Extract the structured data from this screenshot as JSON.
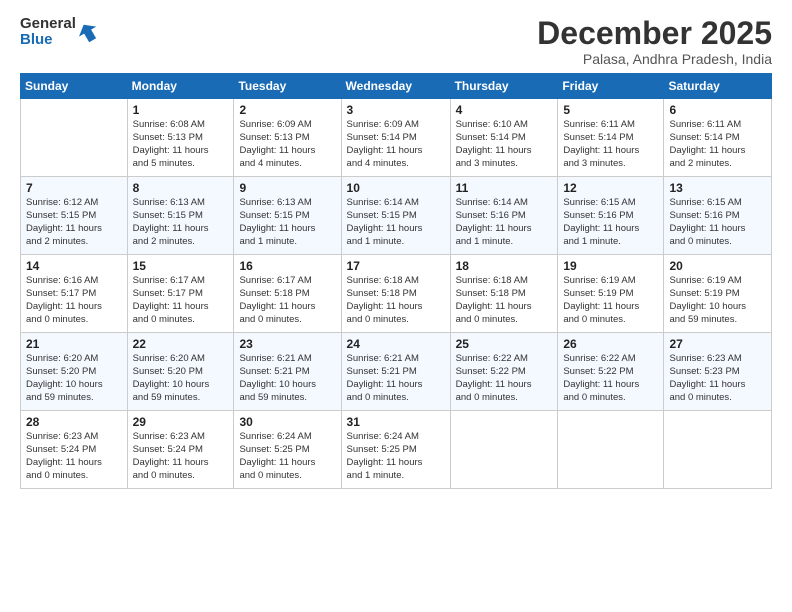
{
  "logo": {
    "line1": "General",
    "line2": "Blue"
  },
  "title": "December 2025",
  "location": "Palasa, Andhra Pradesh, India",
  "days_of_week": [
    "Sunday",
    "Monday",
    "Tuesday",
    "Wednesday",
    "Thursday",
    "Friday",
    "Saturday"
  ],
  "rows": [
    [
      {
        "day": "",
        "info": ""
      },
      {
        "day": "1",
        "info": "Sunrise: 6:08 AM\nSunset: 5:13 PM\nDaylight: 11 hours\nand 5 minutes."
      },
      {
        "day": "2",
        "info": "Sunrise: 6:09 AM\nSunset: 5:13 PM\nDaylight: 11 hours\nand 4 minutes."
      },
      {
        "day": "3",
        "info": "Sunrise: 6:09 AM\nSunset: 5:14 PM\nDaylight: 11 hours\nand 4 minutes."
      },
      {
        "day": "4",
        "info": "Sunrise: 6:10 AM\nSunset: 5:14 PM\nDaylight: 11 hours\nand 3 minutes."
      },
      {
        "day": "5",
        "info": "Sunrise: 6:11 AM\nSunset: 5:14 PM\nDaylight: 11 hours\nand 3 minutes."
      },
      {
        "day": "6",
        "info": "Sunrise: 6:11 AM\nSunset: 5:14 PM\nDaylight: 11 hours\nand 2 minutes."
      }
    ],
    [
      {
        "day": "7",
        "info": "Sunrise: 6:12 AM\nSunset: 5:15 PM\nDaylight: 11 hours\nand 2 minutes."
      },
      {
        "day": "8",
        "info": "Sunrise: 6:13 AM\nSunset: 5:15 PM\nDaylight: 11 hours\nand 2 minutes."
      },
      {
        "day": "9",
        "info": "Sunrise: 6:13 AM\nSunset: 5:15 PM\nDaylight: 11 hours\nand 1 minute."
      },
      {
        "day": "10",
        "info": "Sunrise: 6:14 AM\nSunset: 5:15 PM\nDaylight: 11 hours\nand 1 minute."
      },
      {
        "day": "11",
        "info": "Sunrise: 6:14 AM\nSunset: 5:16 PM\nDaylight: 11 hours\nand 1 minute."
      },
      {
        "day": "12",
        "info": "Sunrise: 6:15 AM\nSunset: 5:16 PM\nDaylight: 11 hours\nand 1 minute."
      },
      {
        "day": "13",
        "info": "Sunrise: 6:15 AM\nSunset: 5:16 PM\nDaylight: 11 hours\nand 0 minutes."
      }
    ],
    [
      {
        "day": "14",
        "info": "Sunrise: 6:16 AM\nSunset: 5:17 PM\nDaylight: 11 hours\nand 0 minutes."
      },
      {
        "day": "15",
        "info": "Sunrise: 6:17 AM\nSunset: 5:17 PM\nDaylight: 11 hours\nand 0 minutes."
      },
      {
        "day": "16",
        "info": "Sunrise: 6:17 AM\nSunset: 5:18 PM\nDaylight: 11 hours\nand 0 minutes."
      },
      {
        "day": "17",
        "info": "Sunrise: 6:18 AM\nSunset: 5:18 PM\nDaylight: 11 hours\nand 0 minutes."
      },
      {
        "day": "18",
        "info": "Sunrise: 6:18 AM\nSunset: 5:18 PM\nDaylight: 11 hours\nand 0 minutes."
      },
      {
        "day": "19",
        "info": "Sunrise: 6:19 AM\nSunset: 5:19 PM\nDaylight: 11 hours\nand 0 minutes."
      },
      {
        "day": "20",
        "info": "Sunrise: 6:19 AM\nSunset: 5:19 PM\nDaylight: 10 hours\nand 59 minutes."
      }
    ],
    [
      {
        "day": "21",
        "info": "Sunrise: 6:20 AM\nSunset: 5:20 PM\nDaylight: 10 hours\nand 59 minutes."
      },
      {
        "day": "22",
        "info": "Sunrise: 6:20 AM\nSunset: 5:20 PM\nDaylight: 10 hours\nand 59 minutes."
      },
      {
        "day": "23",
        "info": "Sunrise: 6:21 AM\nSunset: 5:21 PM\nDaylight: 10 hours\nand 59 minutes."
      },
      {
        "day": "24",
        "info": "Sunrise: 6:21 AM\nSunset: 5:21 PM\nDaylight: 11 hours\nand 0 minutes."
      },
      {
        "day": "25",
        "info": "Sunrise: 6:22 AM\nSunset: 5:22 PM\nDaylight: 11 hours\nand 0 minutes."
      },
      {
        "day": "26",
        "info": "Sunrise: 6:22 AM\nSunset: 5:22 PM\nDaylight: 11 hours\nand 0 minutes."
      },
      {
        "day": "27",
        "info": "Sunrise: 6:23 AM\nSunset: 5:23 PM\nDaylight: 11 hours\nand 0 minutes."
      }
    ],
    [
      {
        "day": "28",
        "info": "Sunrise: 6:23 AM\nSunset: 5:24 PM\nDaylight: 11 hours\nand 0 minutes."
      },
      {
        "day": "29",
        "info": "Sunrise: 6:23 AM\nSunset: 5:24 PM\nDaylight: 11 hours\nand 0 minutes."
      },
      {
        "day": "30",
        "info": "Sunrise: 6:24 AM\nSunset: 5:25 PM\nDaylight: 11 hours\nand 0 minutes."
      },
      {
        "day": "31",
        "info": "Sunrise: 6:24 AM\nSunset: 5:25 PM\nDaylight: 11 hours\nand 1 minute."
      },
      {
        "day": "",
        "info": ""
      },
      {
        "day": "",
        "info": ""
      },
      {
        "day": "",
        "info": ""
      }
    ]
  ]
}
